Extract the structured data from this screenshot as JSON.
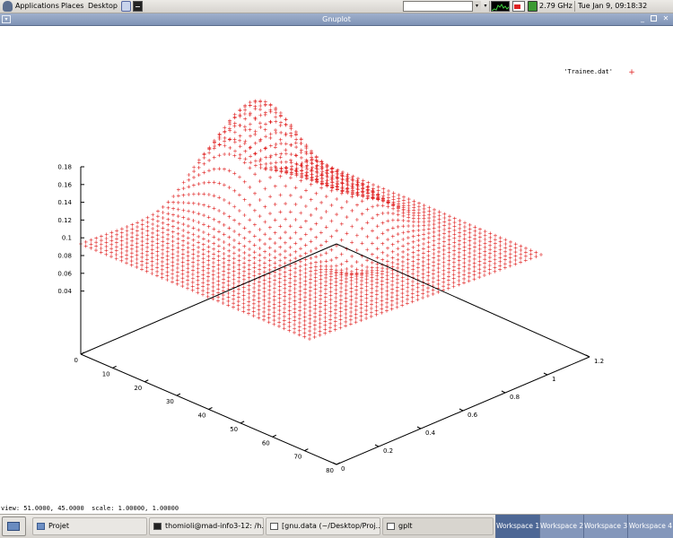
{
  "top_panel": {
    "menus": [
      "Applications",
      "Places",
      "Desktop"
    ],
    "cpu_freq": "2.79 GHz",
    "clock": "Tue Jan  9, 09:18:32"
  },
  "window": {
    "title": "Gnuplot"
  },
  "plot": {
    "legend_label": "'Trainee.dat'",
    "legend_symbol": "+",
    "series_color": "#e02020",
    "z_ticks": [
      "0.18",
      "0.16",
      "0.14",
      "0.12",
      "0.1",
      "0.08",
      "0.06",
      "0.04"
    ],
    "x_ticks": [
      "0",
      "10",
      "20",
      "30",
      "40",
      "50",
      "60",
      "70",
      "80"
    ],
    "y_ticks": [
      "0",
      "0.2",
      "0.4",
      "0.6",
      "0.8",
      "1",
      "1.2"
    ],
    "status": "view: 51.0000, 45.0000  scale: 1.00000, 1.00000"
  },
  "taskbar": {
    "tasks": [
      "Projet",
      "thomioli@mad-info3-12: /h...",
      "[gnu.data (~/Desktop/Proj...",
      "gplt"
    ],
    "workspaces": [
      "Workspace 1",
      "Workspace 2",
      "Workspace 3",
      "Workspace 4"
    ]
  }
}
